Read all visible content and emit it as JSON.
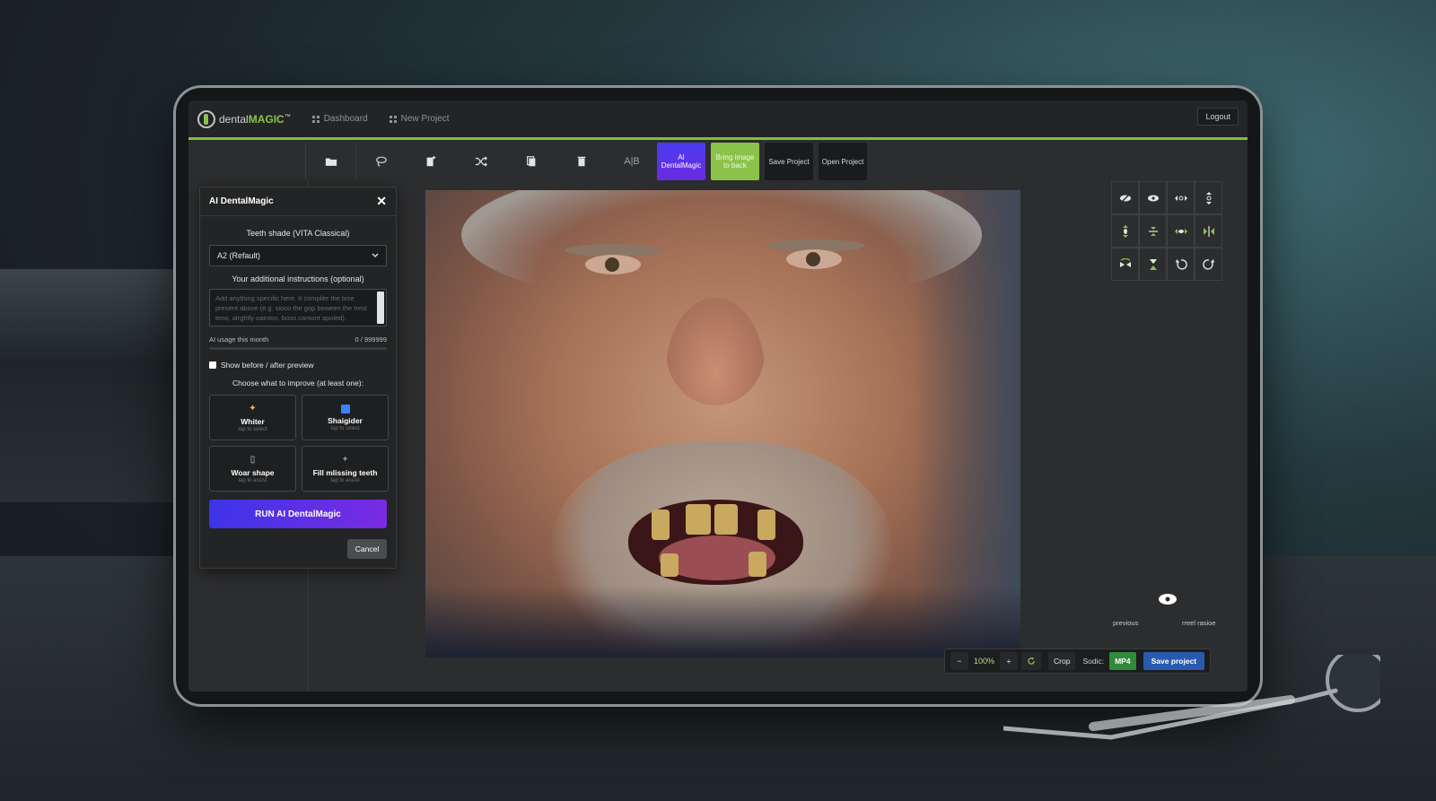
{
  "app": {
    "logo_prefix": "dental",
    "logo_brand": "MAGIC",
    "logo_tm": "™"
  },
  "nav": {
    "dashboard": "Dashboard",
    "new_project": "New Project",
    "logout": "Logout"
  },
  "toolbar": {
    "ab_label": "A|B",
    "ai_dentalmagic": "AI DentalMagic",
    "bring_back": "Bring image to back",
    "save_project": "Save Project",
    "open_project": "Open Project"
  },
  "ai_panel": {
    "title": "AI DentalMagic",
    "close": "✕",
    "shade_label": "Teeth shade (VITA Classical)",
    "shade_value": "A2 (Refault)",
    "instructions_label": "Your additional instructions (optional)",
    "instructions_placeholder": "Add anything specific here. It complite the bise present above (e.g. sioco the gop beween the trest teno, alrghtly oainton, boso camont apoled).",
    "usage_label": "AI usage this month",
    "usage_value": "0 / 999999",
    "usage_fraction": 0,
    "preview_label": "Show before / after preview",
    "choose_label": "Choose what to improve (at least one):",
    "options": [
      {
        "icon": "sparkle-icon",
        "label": "Whiter",
        "sub": "tap to select"
      },
      {
        "icon": "straighten-icon",
        "label": "Shaigider",
        "sub": "tap to select"
      },
      {
        "icon": "shape-icon",
        "label": "Woar shape",
        "sub": "tap to assist"
      },
      {
        "icon": "plus-icon",
        "label": "Fill mlissing teeth",
        "sub": "tap to assist"
      }
    ],
    "run_label": "RUN AI DentalMagic",
    "cancel_label": "Cancel"
  },
  "right_panel": {
    "previous": "previous",
    "next": "rreel rasioe"
  },
  "bottom_bar": {
    "minus": "−",
    "zoom": "100%",
    "plus": "+",
    "crop": "Crop",
    "export_label": "Sodic:",
    "mp4": "MP4",
    "save": "Save project"
  },
  "colors": {
    "accent_green": "#8bc34a",
    "ai_purple": "#5a36ec",
    "save_blue": "#2a5ab0"
  }
}
